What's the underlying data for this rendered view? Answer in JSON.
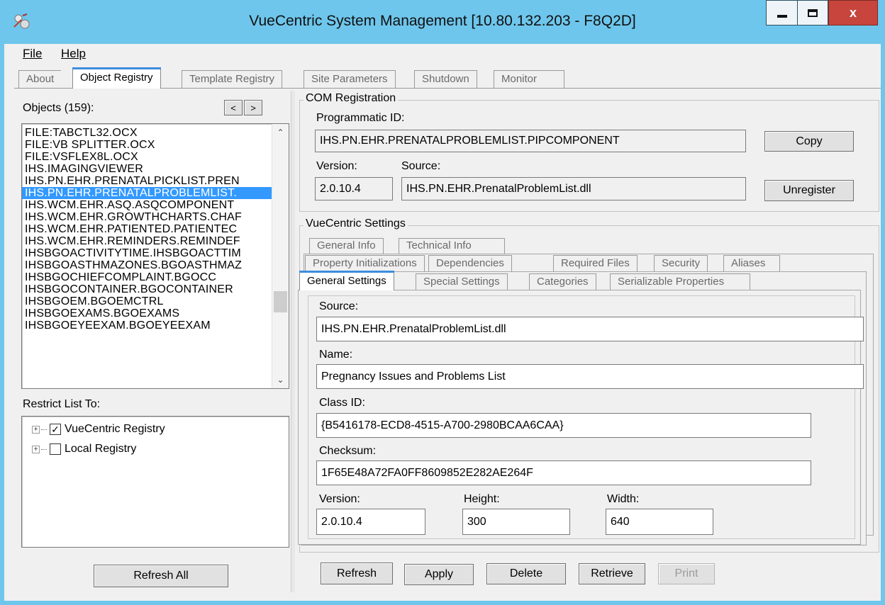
{
  "window": {
    "title": "VueCentric System Management  [10.80.132.203 - F8Q2D]",
    "controls": {
      "minimize": "_",
      "maximize": "□",
      "close": "x"
    }
  },
  "menu": {
    "file": "File",
    "help": "Help"
  },
  "main_tabs": [
    "About",
    "Object Registry",
    "Template Registry",
    "Site Parameters",
    "Shutdown",
    "Monitor"
  ],
  "left": {
    "objects_label": "Objects (159):",
    "nav_prev": "<",
    "nav_next": ">",
    "objects": [
      "FILE:TABCTL32.OCX",
      "FILE:VB SPLITTER.OCX",
      "FILE:VSFLEX8L.OCX",
      "IHS.IMAGINGVIEWER",
      "IHS.PN.EHR.PRENATALPICKLIST.PREN",
      "IHS.PN.EHR.PRENATALPROBLEMLIST.",
      "IHS.WCM.EHR.ASQ.ASQCOMPONENT",
      "IHS.WCM.EHR.GROWTHCHARTS.CHAF",
      "IHS.WCM.EHR.PATIENTED.PATIENTEC",
      "IHS.WCM.EHR.REMINDERS.REMINDEF",
      "IHSBGOACTIVITYTIME.IHSBGOACTTIM",
      "IHSBGOASTHMAZONES.BGOASTHMAZ",
      "IHSBGOCHIEFCOMPLAINT.BGOCC",
      "IHSBGOCONTAINER.BGOCONTAINER",
      "IHSBGOEM.BGOEMCTRL",
      "IHSBGOEXAMS.BGOEXAMS",
      "IHSBGOEYEEXAM.BGOEYEEXAM"
    ],
    "selected_index": 5,
    "restrict_label": "Restrict List To:",
    "restrict_items": [
      {
        "label": "VueCentric Registry",
        "checked": true
      },
      {
        "label": "Local Registry",
        "checked": false
      }
    ],
    "refresh_all": "Refresh All"
  },
  "com": {
    "group_title": "COM Registration",
    "progid_label": "Programmatic ID:",
    "progid_value": "IHS.PN.EHR.PRENATALPROBLEMLIST.PIPCOMPONENT",
    "copy": "Copy",
    "version_label": "Version:",
    "version_value": "2.0.10.4",
    "source_label": "Source:",
    "source_value": "IHS.PN.EHR.PrenatalProblemList.dll",
    "unregister": "Unregister"
  },
  "vc": {
    "group_title": "VueCentric Settings",
    "tabs_row1": [
      "General Info",
      "Technical Info"
    ],
    "tabs_row2": [
      "Property Initializations",
      "Dependencies",
      "Required Files",
      "Security",
      "Aliases"
    ],
    "tabs_row3": [
      "General Settings",
      "Special Settings",
      "Categories",
      "Serializable Properties"
    ],
    "source_label": "Source:",
    "source_value": "IHS.PN.EHR.PrenatalProblemList.dll",
    "name_label": "Name:",
    "name_value": "Pregnancy Issues and Problems List",
    "classid_label": "Class ID:",
    "classid_value": "{B5416178-ECD8-4515-A700-2980BCAA6CAA}",
    "checksum_label": "Checksum:",
    "checksum_value": "1F65E48A72FA0FF8609852E282AE264F",
    "version_label": "Version:",
    "version_value": "2.0.10.4",
    "height_label": "Height:",
    "height_value": "300",
    "width_label": "Width:",
    "width_value": "640"
  },
  "bottom_buttons": {
    "refresh": "Refresh",
    "apply": "Apply",
    "delete": "Delete",
    "retrieve": "Retrieve",
    "print": "Print"
  }
}
